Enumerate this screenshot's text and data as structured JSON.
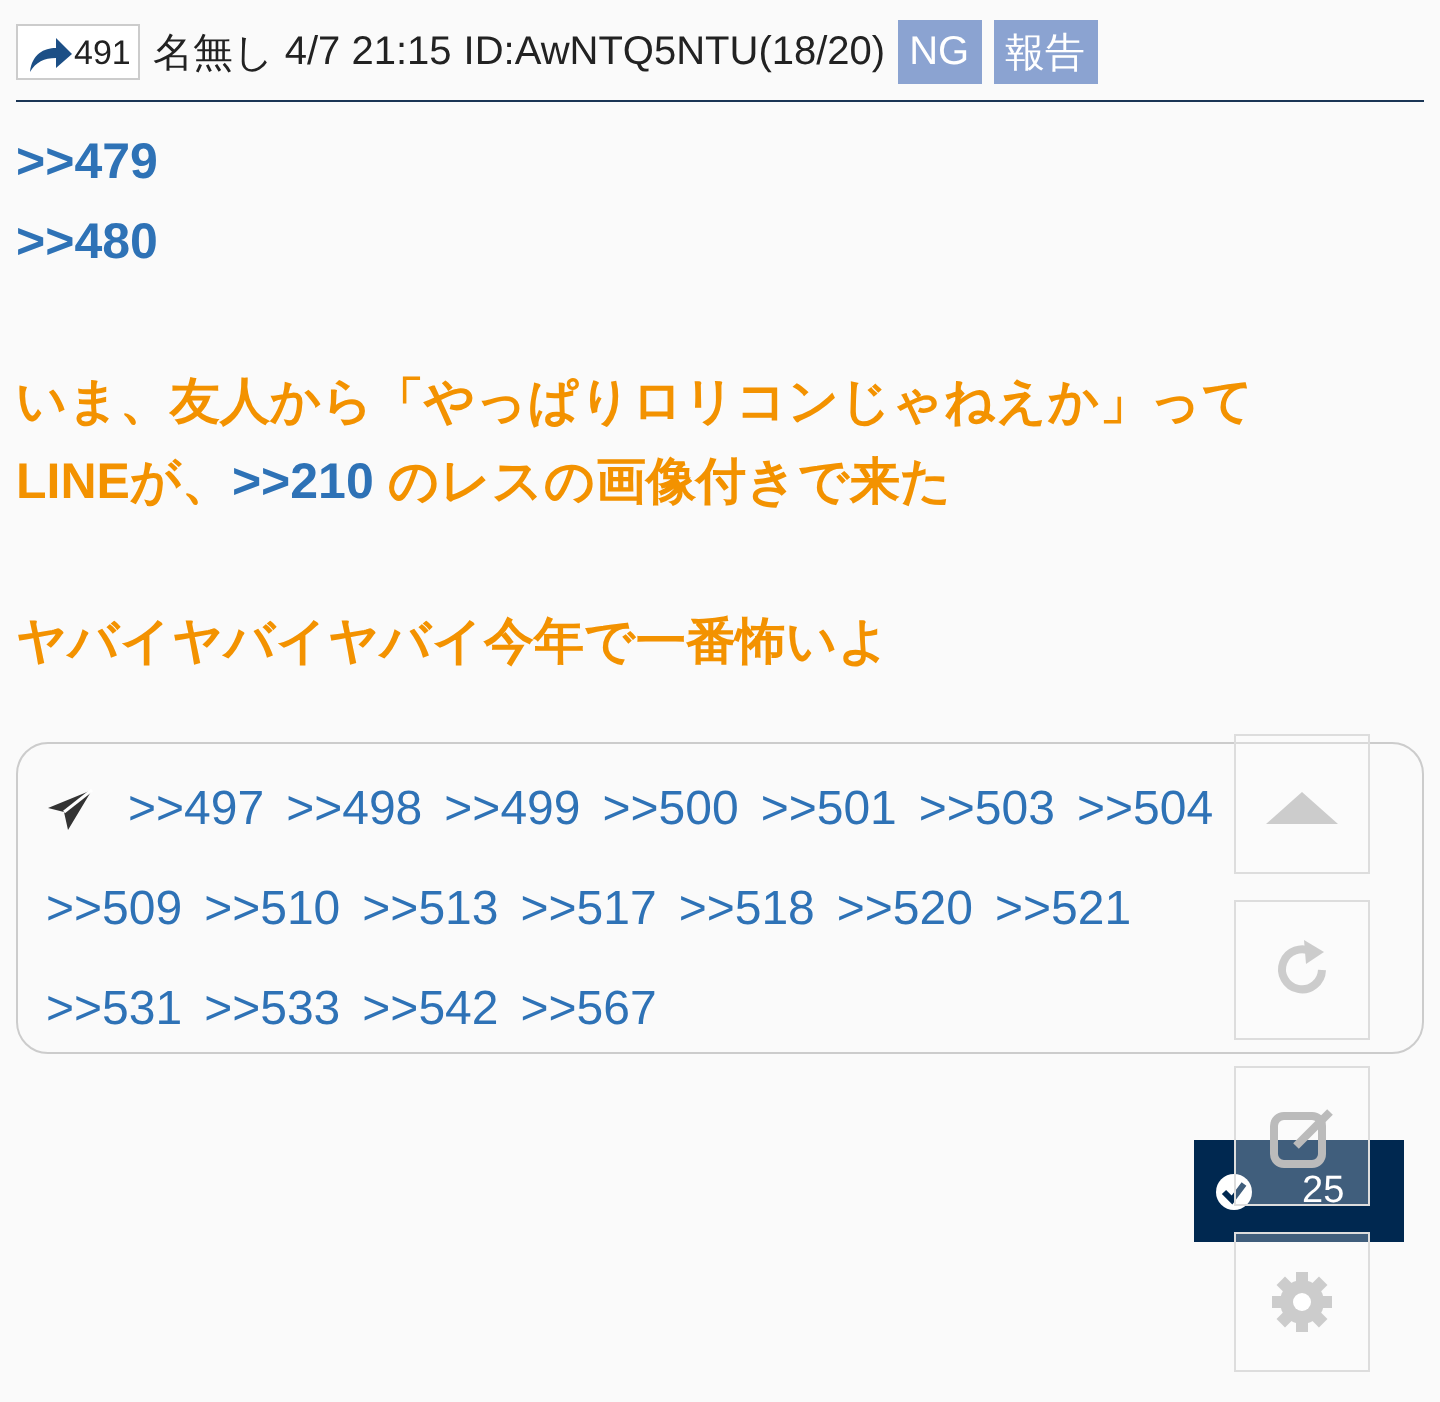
{
  "post": {
    "reply_count": "491",
    "name": "名無し",
    "date": "4/7 21:15",
    "id": "ID:AwNTQ5NTU(18/20)",
    "actions": [
      "NG",
      "報告"
    ]
  },
  "anchors": [
    ">>479",
    ">>480"
  ],
  "body": [
    [
      [
        {
          "kind": "text",
          "text": "いま、友人から「やっぱりロリコンじゃねえか」って"
        }
      ],
      [
        {
          "kind": "text",
          "text": "LINEが、"
        },
        {
          "kind": "link",
          "text": ">>210"
        },
        {
          "kind": "text",
          "text": " のレスの画像付きで来た"
        }
      ]
    ],
    [
      [
        {
          "kind": "text",
          "text": "ヤバイヤバイヤバイ今年で一番怖いよ"
        }
      ]
    ]
  ],
  "replies": [
    ">>497",
    ">>498",
    ">>499",
    ">>500",
    ">>501",
    ">>503",
    ">>504",
    ">>509",
    ">>510",
    ">>513",
    ">>517",
    ">>518",
    ">>520",
    ">>521",
    ">>531",
    ">>533",
    ">>542",
    ">>567"
  ],
  "float_buttons": [
    {
      "kind": "up"
    },
    {
      "kind": "reload"
    },
    {
      "kind": "edit"
    },
    {
      "kind": "settings"
    }
  ],
  "badge": {
    "count": "25"
  }
}
